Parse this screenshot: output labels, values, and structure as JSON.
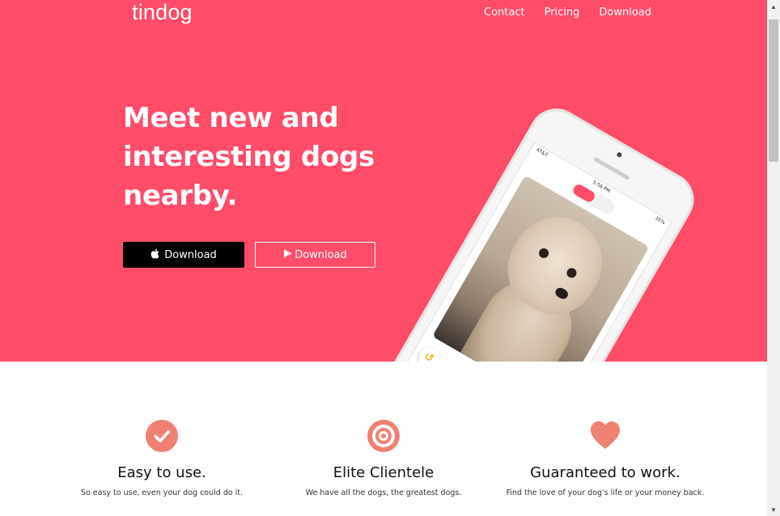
{
  "navbar": {
    "brand": "tindog",
    "links": [
      "Contact",
      "Pricing",
      "Download"
    ]
  },
  "hero": {
    "headline_lines": [
      "Meet new and",
      "interesting dogs",
      "nearby."
    ],
    "buttons": {
      "apple_label": "Download",
      "apple_icon": "apple-icon",
      "play_label": "Download",
      "play_icon": "google-play-icon"
    },
    "phone": {
      "carrier": "AT&T",
      "time": "5:56 PM",
      "battery": "35%"
    }
  },
  "features": [
    {
      "icon": "check-circle-icon",
      "title": "Easy to use.",
      "text": "So easy to use, even your dog could do it."
    },
    {
      "icon": "bullseye-icon",
      "title": "Elite Clientele",
      "text": "We have all the dogs, the greatest dogs."
    },
    {
      "icon": "heart-icon",
      "title": "Guaranteed to work.",
      "text": "Find the love of your dog's life or your money back."
    }
  ],
  "colors": {
    "hero_bg": "#ff4c68",
    "feature_icon": "#ef8172",
    "black_button": "#000000"
  }
}
